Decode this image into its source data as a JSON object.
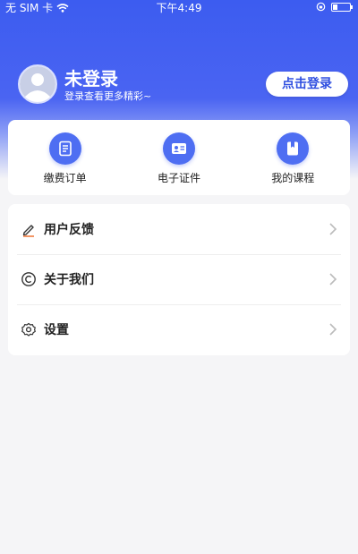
{
  "status_bar": {
    "carrier": "无 SIM 卡",
    "time": "下午4:49"
  },
  "profile": {
    "name": "未登录",
    "subtitle": "登录查看更多精彩~",
    "login_label": "点击登录"
  },
  "shortcuts": [
    {
      "label": "缴费订单",
      "icon": "order-list-icon"
    },
    {
      "label": "电子证件",
      "icon": "id-card-icon"
    },
    {
      "label": "我的课程",
      "icon": "course-book-icon"
    }
  ],
  "menu": [
    {
      "label": "用户反馈",
      "icon": "pencil-icon"
    },
    {
      "label": "关于我们",
      "icon": "copyright-icon"
    },
    {
      "label": "设置",
      "icon": "gear-icon"
    }
  ],
  "colors": {
    "primary": "#3c5cf0",
    "icon_blue": "#4e6ef2",
    "page_bg": "#f5f5f7"
  }
}
